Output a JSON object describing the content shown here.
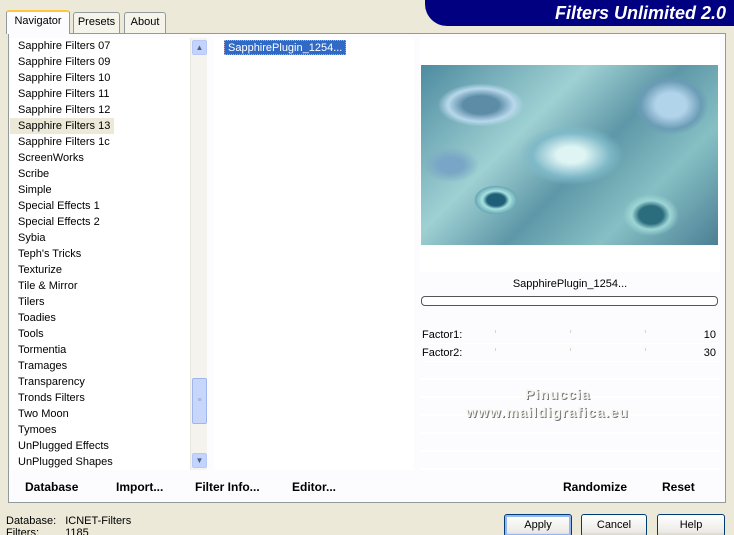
{
  "tabs": [
    "Navigator",
    "Presets",
    "About"
  ],
  "app_title": "Filters Unlimited 2.0",
  "categories": [
    "Sapphire Filters 07",
    "Sapphire Filters 09",
    "Sapphire Filters 10",
    "Sapphire Filters 11",
    "Sapphire Filters 12",
    "Sapphire Filters 13",
    "Sapphire Filters 1c",
    "ScreenWorks",
    "Scribe",
    "Simple",
    "Special Effects 1",
    "Special Effects 2",
    "Sybia",
    "Teph's Tricks",
    "Texturize",
    "Tile & Mirror",
    "Tilers",
    "Toadies",
    "Tools",
    "Tormentia",
    "Tramages",
    "Transparency",
    "Tronds Filters",
    "Two Moon",
    "Tymoes",
    "UnPlugged Effects",
    "UnPlugged Shapes"
  ],
  "selected_category": "Sapphire Filters 13",
  "filter_selected": "SapphirePlugin_1254...",
  "preview_name": "SapphirePlugin_1254...",
  "params": [
    {
      "label": "Factor1:",
      "value": "10"
    },
    {
      "label": "Factor2:",
      "value": "30"
    }
  ],
  "watermark": {
    "line1": "Pinuccia",
    "line2": "www.maildigrafica.eu"
  },
  "bottom_links": {
    "database": "Database",
    "import": "Import...",
    "filter_info": "Filter Info...",
    "editor": "Editor...",
    "randomize": "Randomize",
    "reset": "Reset"
  },
  "status": {
    "database_label": "Database:",
    "database_value": "ICNET-Filters",
    "filters_label": "Filters:",
    "filters_value": "1185"
  },
  "buttons": {
    "apply": "Apply",
    "cancel": "Cancel",
    "help": "Help"
  },
  "colors": {
    "banner": "#000080",
    "selection": "#316ac5",
    "face": "#ece9d8"
  }
}
